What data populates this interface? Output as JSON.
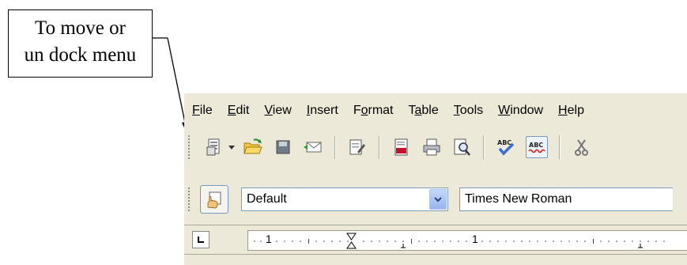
{
  "callout": {
    "line1": "To move or",
    "line2": "un dock menu"
  },
  "menu": {
    "items": [
      {
        "key": "F",
        "rest": "ile"
      },
      {
        "key": "E",
        "rest": "dit"
      },
      {
        "key": "V",
        "rest": "iew"
      },
      {
        "key": "I",
        "rest": "nsert"
      },
      {
        "pre": "F",
        "key": "o",
        "rest": "rmat"
      },
      {
        "pre": "T",
        "key": "a",
        "rest": "ble"
      },
      {
        "key": "T",
        "rest": "ools"
      },
      {
        "key": "W",
        "rest": "indow"
      },
      {
        "key": "H",
        "rest": "elp"
      }
    ]
  },
  "standard_toolbar": {
    "icons": [
      "new-document-icon",
      "open-folder-icon",
      "save-icon",
      "email-icon",
      "edit-file-icon",
      "export-pdf-icon",
      "print-icon",
      "page-preview-icon",
      "spellcheck-icon",
      "autospellcheck-icon",
      "cut-icon"
    ]
  },
  "formatting": {
    "paragraph_style": "Default",
    "font_name": "Times New Roman"
  },
  "ruler": {
    "marks": [
      "1",
      "1"
    ]
  },
  "colors": {
    "toolbar_bg": "#ece9d8",
    "accent": "#7a96c4",
    "pdf_red": "#c8102e"
  }
}
